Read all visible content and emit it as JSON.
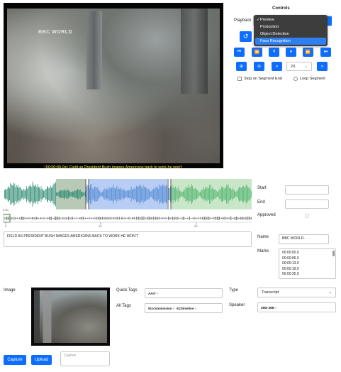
{
  "video": {
    "watermark": "BBC WORLD",
    "subtitle": "[00:00:00.0s]: Field as President Bush images Americans back to work he won't"
  },
  "controls": {
    "title": "Controls",
    "playback_label": "Playback",
    "playback_options": [
      "Preview",
      "Production",
      "Object Detection",
      "Face Recognition"
    ],
    "playback_checked": "Preview",
    "playback_highlighted": "Face Recognition",
    "speed_value": "2X",
    "stop_on_segment_end_label": "Stop on Segment End",
    "loop_segment_label": "Loop Segment",
    "stop_on_segment_end_checked": false,
    "loop_segment_checked": false
  },
  "segment": {
    "start_label": "Start",
    "end_label": "End",
    "approved_label": "Approved",
    "start_value": "",
    "end_value": "",
    "approved_checked": false,
    "transcript_text": "FIELD AS PRESIDENT BUSH IMAGES AMERICANS BACK TO WORK HE WON'T",
    "name_label": "Name",
    "name_value": "BBC WORLD-",
    "marks_label": "Marks",
    "marks": [
      "00:00:00.0",
      "00:00:06.0",
      "00:00:13.0",
      "00:00:19.0",
      "00:00:35.0"
    ]
  },
  "timeline": {
    "tick_labels": [
      "0",
      "10",
      "20"
    ],
    "playhead_label": "0.00"
  },
  "image_section": {
    "image_label": "Image",
    "capture_label": "Capture",
    "upload_label": "Upload",
    "caption_placeholder": "Caption",
    "quick_tags_label": "Quick Tags",
    "quick_tags": [
      "AAIY"
    ],
    "all_tags_label": "All Tags",
    "all_tags": [
      "911commission",
      "911timeline"
    ],
    "type_label": "Type",
    "type_value": "Transcript",
    "speaker_label": "Speaker",
    "speakers": [
      "28W 46B"
    ]
  },
  "colors": {
    "accent": "#0d6efd",
    "region_green": "#b8c9b6",
    "region_blue": "#b7cdf3",
    "region_light_green": "#c9e6c8",
    "wave_teal": "#2e8b73",
    "wave_blue": "#5a8fd6",
    "wave_green": "#58b873"
  },
  "icons": {
    "play": "undo-arrow-icon",
    "transport": [
      "skip-start-icon",
      "rewind-icon",
      "step-back-icon",
      "step-forward-icon",
      "fast-forward-icon",
      "skip-end-icon"
    ],
    "zoom": [
      "zoom-in-icon",
      "zoom-out-icon",
      "slow-down-icon",
      "speed-up-icon"
    ]
  }
}
